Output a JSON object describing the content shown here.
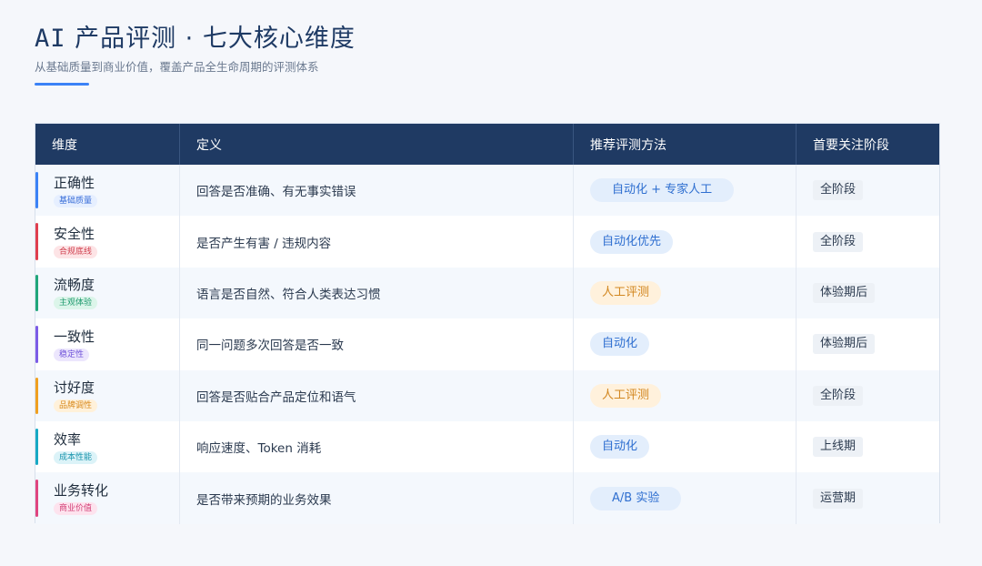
{
  "header": {
    "title_prefix": "AI",
    "title_rest": " 产品评测 · 七大核心维度",
    "subtitle": "从基础质量到商业价值，覆盖产品全生命周期的评测体系"
  },
  "table": {
    "columns": [
      "维度",
      "定义",
      "推荐评测方法",
      "首要关注阶段"
    ],
    "rows": [
      {
        "name": "正确性",
        "tag": "基础质量",
        "definition": "回答是否准确、有无事实错误",
        "method": "自动化 + 专家人工",
        "stage": "全阶段",
        "accent": "#3b82f6",
        "tag_bg": "#e6efff",
        "tag_fg": "#3b6fd8",
        "method_type": "auto"
      },
      {
        "name": "安全性",
        "tag": "合规底线",
        "definition": "是否产生有害 / 违规内容",
        "method": "自动化优先",
        "stage": "全阶段",
        "accent": "#e03e4e",
        "tag_bg": "#fde4e6",
        "tag_fg": "#d0404f",
        "method_type": "auto"
      },
      {
        "name": "流畅度",
        "tag": "主观体验",
        "definition": "语言是否自然、符合人类表达习惯",
        "method": "人工评测",
        "stage": "体验期后",
        "accent": "#21a67a",
        "tag_bg": "#dcf5ea",
        "tag_fg": "#1f9a6e",
        "method_type": "human"
      },
      {
        "name": "一致性",
        "tag": "稳定性",
        "definition": "同一问题多次回答是否一致",
        "method": "自动化",
        "stage": "体验期后",
        "accent": "#7c5ce6",
        "tag_bg": "#ece6fd",
        "tag_fg": "#6f52d9",
        "method_type": "auto"
      },
      {
        "name": "讨好度",
        "tag": "品牌调性",
        "definition": "回答是否贴合产品定位和语气",
        "method": "人工评测",
        "stage": "全阶段",
        "accent": "#f0a020",
        "tag_bg": "#fff1da",
        "tag_fg": "#d8891a",
        "method_type": "human"
      },
      {
        "name": "效率",
        "tag": "成本性能",
        "definition": "响应速度、Token 消耗",
        "method": "自动化",
        "stage": "上线期",
        "accent": "#17a9c4",
        "tag_bg": "#dcf3f8",
        "tag_fg": "#1a95ad",
        "method_type": "auto"
      },
      {
        "name": "业务转化",
        "tag": "商业价值",
        "definition": "是否带来预期的业务效果",
        "method": "A/B 实验",
        "stage": "运营期",
        "accent": "#e0457f",
        "tag_bg": "#fde3ee",
        "tag_fg": "#d23f76",
        "method_type": "auto"
      }
    ]
  },
  "colors": {
    "auto_pill_bg": "#e3eefc",
    "auto_pill_fg": "#2f6fd0",
    "human_pill_bg": "#fff1dc",
    "human_pill_fg": "#d2861f",
    "header_bg": "#1f3a63"
  }
}
